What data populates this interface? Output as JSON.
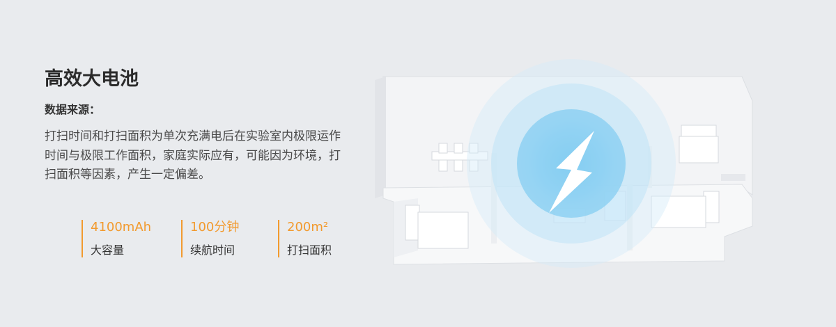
{
  "title": "高效大电池",
  "source_label": "数据来源：",
  "description": "打扫时间和打扫面积为单次充满电后在实验室内极限运作时间与极限工作面积，家庭实际应有，可能因为环境，打扫面积等因素，产生一定偏差。",
  "stats": [
    {
      "value": "4100mAh",
      "label": "大容量"
    },
    {
      "value": "100分钟",
      "label": "续航时间"
    },
    {
      "value": "200m²",
      "label": "打扫面积"
    }
  ],
  "colors": {
    "background": "#e9ebee",
    "accent": "#f29a2e",
    "glow": "#8fd1f2"
  },
  "icons": [
    "lightning-bolt-icon"
  ]
}
